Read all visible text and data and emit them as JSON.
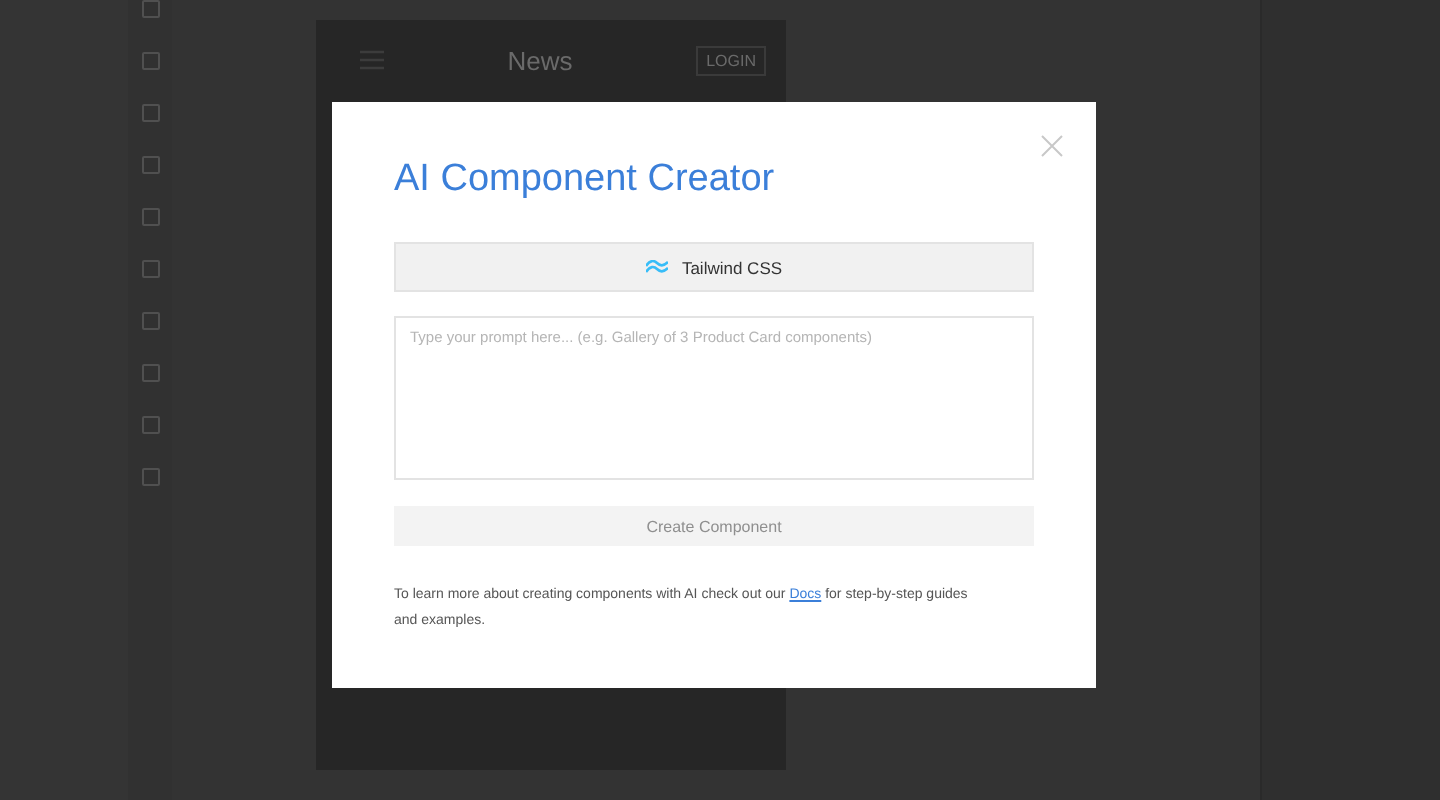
{
  "preview": {
    "title": "News",
    "login": "LOGIN"
  },
  "modal": {
    "title": "AI Component Creator",
    "framework_button": "Tailwind CSS",
    "prompt": {
      "placeholder": "Type your prompt here... (e.g. Gallery of 3 Product Card components)"
    },
    "create_button": {
      "label": "Create Component",
      "disabled": true
    },
    "note": {
      "before": "To learn more about creating components with AI check out our",
      "link": "Docs",
      "after": "for step-by-step guides and examples."
    }
  }
}
